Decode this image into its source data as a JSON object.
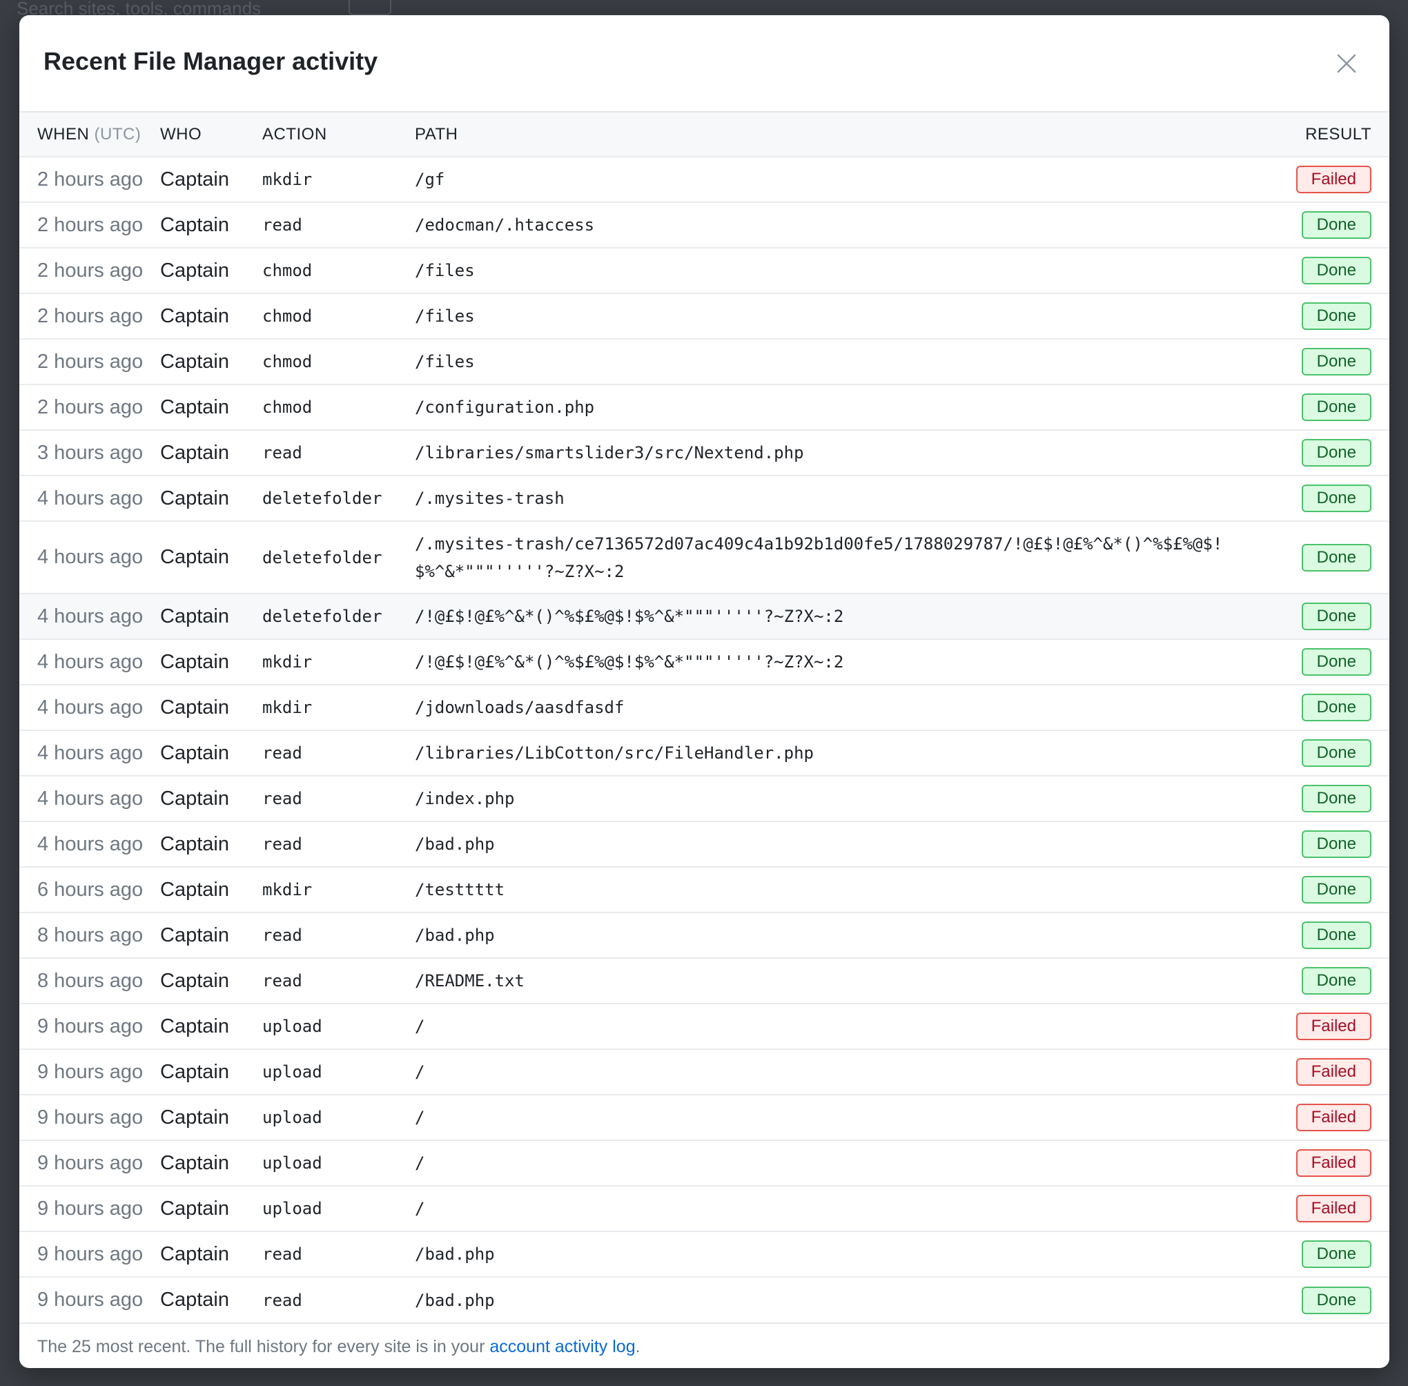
{
  "background": {
    "search_placeholder": "Search sites, tools, commands"
  },
  "modal": {
    "title": "Recent File Manager activity",
    "close_label": "×",
    "columns": {
      "when": "WHEN",
      "when_tz": "(UTC)",
      "who": "WHO",
      "action": "ACTION",
      "path": "PATH",
      "result": "RESULT"
    },
    "rows": [
      {
        "when": "2 hours ago",
        "who": "Captain",
        "action": "mkdir",
        "path": "/gf",
        "result": "Failed"
      },
      {
        "when": "2 hours ago",
        "who": "Captain",
        "action": "read",
        "path": "/edocman/.htaccess",
        "result": "Done"
      },
      {
        "when": "2 hours ago",
        "who": "Captain",
        "action": "chmod",
        "path": "/files",
        "result": "Done"
      },
      {
        "when": "2 hours ago",
        "who": "Captain",
        "action": "chmod",
        "path": "/files",
        "result": "Done"
      },
      {
        "when": "2 hours ago",
        "who": "Captain",
        "action": "chmod",
        "path": "/files",
        "result": "Done"
      },
      {
        "when": "2 hours ago",
        "who": "Captain",
        "action": "chmod",
        "path": "/configuration.php",
        "result": "Done"
      },
      {
        "when": "3 hours ago",
        "who": "Captain",
        "action": "read",
        "path": "/libraries/smartslider3/src/Nextend.php",
        "result": "Done"
      },
      {
        "when": "4 hours ago",
        "who": "Captain",
        "action": "deletefolder",
        "path": "/.mysites-trash",
        "result": "Done"
      },
      {
        "when": "4 hours ago",
        "who": "Captain",
        "action": "deletefolder",
        "path": "/.mysites-trash/ce7136572d07ac409c4a1b92b1d00fe5/1788029787/!@£$!@£%^&*()^%$£%@$!$%^&*\"\"\"'''''?~Z?X~:2",
        "result": "Done"
      },
      {
        "when": "4 hours ago",
        "who": "Captain",
        "action": "deletefolder",
        "path": "/!@£$!@£%^&*()^%$£%@$!$%^&*\"\"\"'''''?~Z?X~:2",
        "result": "Done"
      },
      {
        "when": "4 hours ago",
        "who": "Captain",
        "action": "mkdir",
        "path": "/!@£$!@£%^&*()^%$£%@$!$%^&*\"\"\"'''''?~Z?X~:2",
        "result": "Done"
      },
      {
        "when": "4 hours ago",
        "who": "Captain",
        "action": "mkdir",
        "path": "/jdownloads/aasdfasdf",
        "result": "Done"
      },
      {
        "when": "4 hours ago",
        "who": "Captain",
        "action": "read",
        "path": "/libraries/LibCotton/src/FileHandler.php",
        "result": "Done"
      },
      {
        "when": "4 hours ago",
        "who": "Captain",
        "action": "read",
        "path": "/index.php",
        "result": "Done"
      },
      {
        "when": "4 hours ago",
        "who": "Captain",
        "action": "read",
        "path": "/bad.php",
        "result": "Done"
      },
      {
        "when": "6 hours ago",
        "who": "Captain",
        "action": "mkdir",
        "path": "/testtttt",
        "result": "Done"
      },
      {
        "when": "8 hours ago",
        "who": "Captain",
        "action": "read",
        "path": "/bad.php",
        "result": "Done"
      },
      {
        "when": "8 hours ago",
        "who": "Captain",
        "action": "read",
        "path": "/README.txt",
        "result": "Done"
      },
      {
        "when": "9 hours ago",
        "who": "Captain",
        "action": "upload",
        "path": "/",
        "result": "Failed"
      },
      {
        "when": "9 hours ago",
        "who": "Captain",
        "action": "upload",
        "path": "/",
        "result": "Failed"
      },
      {
        "when": "9 hours ago",
        "who": "Captain",
        "action": "upload",
        "path": "/",
        "result": "Failed"
      },
      {
        "when": "9 hours ago",
        "who": "Captain",
        "action": "upload",
        "path": "/",
        "result": "Failed"
      },
      {
        "when": "9 hours ago",
        "who": "Captain",
        "action": "upload",
        "path": "/",
        "result": "Failed"
      },
      {
        "when": "9 hours ago",
        "who": "Captain",
        "action": "read",
        "path": "/bad.php",
        "result": "Done"
      },
      {
        "when": "9 hours ago",
        "who": "Captain",
        "action": "read",
        "path": "/bad.php",
        "result": "Done"
      }
    ],
    "footer": {
      "text": "The 25 most recent. The full history for every site is in your",
      "link_label": "account activity log",
      "suffix": "."
    }
  },
  "colors": {
    "done": "#116329",
    "failed": "#a40e26",
    "link": "#0969da"
  }
}
